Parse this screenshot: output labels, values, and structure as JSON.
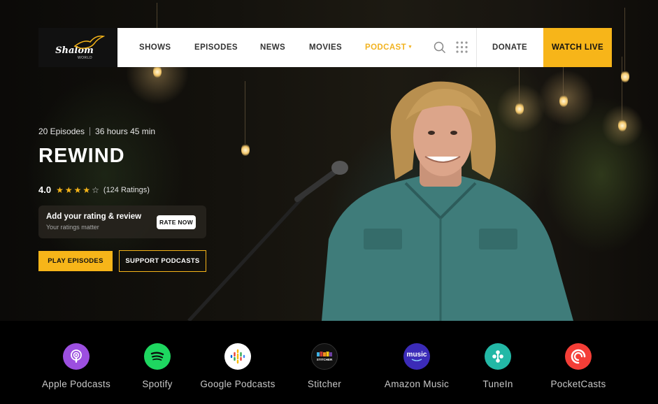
{
  "brand": {
    "logo_text": "Shalom",
    "logo_sub": "WORLD"
  },
  "nav": {
    "items": [
      {
        "label": "SHOWS"
      },
      {
        "label": "EPISODES"
      },
      {
        "label": "NEWS"
      },
      {
        "label": "MOVIES"
      },
      {
        "label": "PODCAST",
        "active": true,
        "has_dropdown": true
      }
    ],
    "icons": [
      "search-icon",
      "apps-grid-icon"
    ],
    "donate_label": "DONATE",
    "watch_live_label": "WATCH LIVE"
  },
  "show": {
    "episodes": "20 Episodes",
    "duration": "36 hours 45 min",
    "title": "REWIND",
    "rating_value": "4.0",
    "stars_filled": 4,
    "stars_total": 5,
    "rating_count": "(124 Ratings)"
  },
  "rate_box": {
    "title": "Add your rating & review",
    "subtitle": "Your ratings matter",
    "button": "RATE NOW"
  },
  "actions": {
    "play_label": "PLAY EPISODES",
    "support_label": "SUPPORT PODCASTS"
  },
  "platforms": [
    {
      "name": "Apple Podcasts",
      "icon": "apple-podcasts-icon",
      "color": "#9c4fe0"
    },
    {
      "name": "Spotify",
      "icon": "spotify-icon",
      "color": "#1ed760"
    },
    {
      "name": "Google Podcasts",
      "icon": "google-podcasts-icon",
      "color": "#ffffff"
    },
    {
      "name": "Stitcher",
      "icon": "stitcher-icon",
      "color": "#111111",
      "badge_text": "STITCHER"
    },
    {
      "name": "Amazon Music",
      "icon": "amazon-music-icon",
      "color": "#3b2bb8",
      "badge_text": "music"
    },
    {
      "name": "TuneIn",
      "icon": "tunein-icon",
      "color": "#23b8a6"
    },
    {
      "name": "PocketCasts",
      "icon": "pocketcasts-icon",
      "color": "#f43e37"
    }
  ],
  "colors": {
    "accent": "#f7b519",
    "nav_bg": "#ffffff",
    "page_bg": "#000000"
  }
}
